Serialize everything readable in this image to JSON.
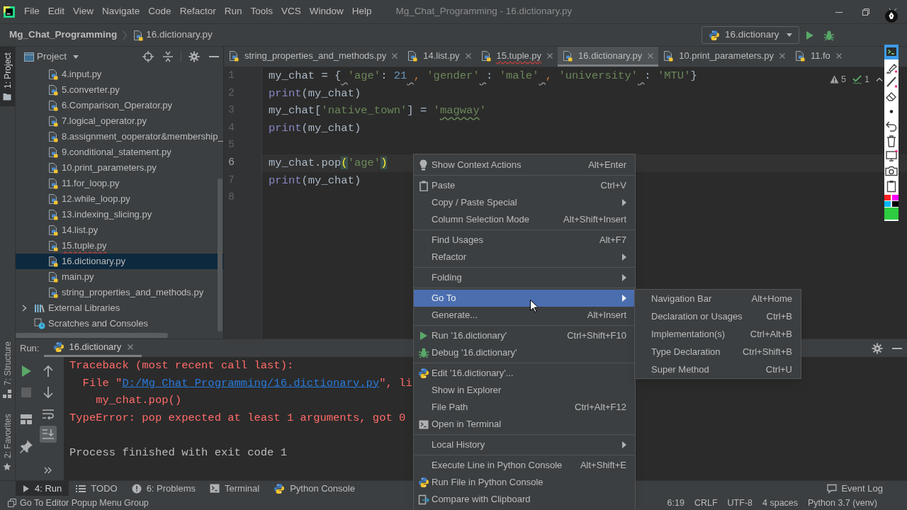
{
  "menu_bar": {
    "items": [
      "File",
      "Edit",
      "View",
      "Navigate",
      "Code",
      "Refactor",
      "Run",
      "Tools",
      "VCS",
      "Window",
      "Help"
    ],
    "title": "Mg_Chat_Programming - 16.dictionary.py"
  },
  "nav_bar": {
    "project": "Mg_Chat_Programming",
    "file": "16.dictionary.py",
    "run_config": "16.dictionary"
  },
  "tool_tabs": [
    {
      "label": "1: Project",
      "kind": "project",
      "selected": true
    },
    {
      "label": "7: Structure",
      "kind": "structure",
      "selected": false
    },
    {
      "label": "2: Favorites",
      "kind": "favorites",
      "selected": false
    }
  ],
  "project_panel": {
    "title": "Project",
    "tree": [
      {
        "children": [
          {
            "label": "4.input.py",
            "selected": false,
            "error": false
          },
          {
            "label": "5.converter.py",
            "selected": false,
            "error": false
          },
          {
            "label": "6.Comparison_Operator.py",
            "selected": false,
            "error": false
          },
          {
            "label": "7.logical_operator.py",
            "selected": false,
            "error": false
          },
          {
            "label": "8.assignment_ooperator&membership_",
            "selected": false,
            "error": false
          },
          {
            "label": "9.conditional_statement.py",
            "selected": false,
            "error": false
          },
          {
            "label": "10.print_parameters.py",
            "selected": false,
            "error": false
          },
          {
            "label": "11.for_loop.py",
            "selected": false,
            "error": false
          },
          {
            "label": "12.while_loop.py",
            "selected": false,
            "error": false
          },
          {
            "label": "13.indexing_slicing.py",
            "selected": false,
            "error": false
          },
          {
            "label": "14.list.py",
            "selected": false,
            "error": false
          },
          {
            "label": "15.tuple.py",
            "selected": false,
            "error": true
          },
          {
            "label": "16.dictionary.py",
            "selected": true,
            "error": false
          },
          {
            "label": "main.py",
            "selected": false,
            "error": false
          },
          {
            "label": "string_properties_and_methods.py",
            "selected": false,
            "error": false
          }
        ]
      },
      {
        "label": "External Libraries",
        "kind": "libraries",
        "expanded": false
      },
      {
        "label": "Scratches and Consoles",
        "kind": "scratches"
      }
    ]
  },
  "editor": {
    "tabs": [
      {
        "label": "string_properties_and_methods.py",
        "selected": false,
        "error": false
      },
      {
        "label": "14.list.py",
        "selected": false,
        "error": false
      },
      {
        "label": "15.tuple.py",
        "selected": false,
        "error": true
      },
      {
        "label": "16.dictionary.py",
        "selected": true,
        "error": false
      },
      {
        "label": "10.print_parameters.py",
        "selected": false,
        "error": false
      },
      {
        "label": "11.fo",
        "selected": false,
        "error": false
      }
    ],
    "lines": [
      {
        "number": "1",
        "current": false,
        "tokens": [
          {
            "text": "my_chat = { ",
            "kind": "plain",
            "space_warning": true
          },
          {
            "text": "'age'",
            "kind": "string",
            "space_warning": false
          },
          {
            "text": ": ",
            "kind": "plain",
            "space_warning": false
          },
          {
            "text": "21 ",
            "kind": "number",
            "space_warning": true
          },
          {
            "text": ", ",
            "kind": "comma",
            "space_warning": false
          },
          {
            "text": "'gender' ",
            "kind": "string",
            "space_warning": true
          },
          {
            "text": ": ",
            "kind": "plain",
            "space_warning": false
          },
          {
            "text": "'male' ",
            "kind": "string",
            "space_warning": true
          },
          {
            "text": ", ",
            "kind": "comma",
            "space_warning": false
          },
          {
            "text": "'university' ",
            "kind": "string",
            "space_warning": true
          },
          {
            "text": ": ",
            "kind": "plain",
            "space_warning": false
          },
          {
            "text": "'MTU'",
            "kind": "string",
            "space_warning": false
          },
          {
            "text": "}",
            "kind": "plain",
            "space_warning": false
          }
        ]
      },
      {
        "number": "2",
        "current": false,
        "tokens": [
          {
            "text": "print",
            "kind": "builtin",
            "space_warning": false
          },
          {
            "text": "(my_chat)",
            "kind": "plain",
            "space_warning": false
          }
        ]
      },
      {
        "number": "3",
        "current": false,
        "tokens": [
          {
            "text": "my_chat[",
            "kind": "plain",
            "space_warning": false
          },
          {
            "text": "'native_town'",
            "kind": "string",
            "space_warning": false
          },
          {
            "text": "] = ",
            "kind": "plain",
            "space_warning": false
          },
          {
            "text": "'",
            "kind": "string",
            "space_warning": false
          },
          {
            "text": "magway",
            "kind": "typo",
            "space_warning": false
          },
          {
            "text": "'",
            "kind": "string",
            "space_warning": false
          }
        ]
      },
      {
        "number": "4",
        "current": false,
        "tokens": [
          {
            "text": "print",
            "kind": "builtin",
            "space_warning": false
          },
          {
            "text": "(my_chat)",
            "kind": "plain",
            "space_warning": false
          }
        ]
      },
      {
        "number": "5",
        "current": false
      },
      {
        "number": "6",
        "current": true,
        "tokens": [
          {
            "text": "my_chat.pop",
            "kind": "plain",
            "space_warning": false
          },
          {
            "text": "(",
            "kind": "paren",
            "space_warning": false
          },
          {
            "text": "'age'",
            "kind": "string",
            "space_warning": false
          },
          {
            "text": ")",
            "kind": "paren",
            "space_warning": false
          }
        ]
      },
      {
        "number": "7",
        "current": false,
        "tokens": [
          {
            "text": "print",
            "kind": "builtin",
            "space_warning": false
          },
          {
            "text": "(my_chat)",
            "kind": "plain",
            "space_warning": false
          }
        ]
      },
      {
        "number": "8",
        "current": false
      }
    ],
    "inspections": {
      "warnings": "5",
      "weak_warnings": "1"
    }
  },
  "context_menu": {
    "groups": [
      [
        {
          "label": "Show Context Actions",
          "shortcut": "Alt+Enter",
          "kind": "hint",
          "submenu": false,
          "selected": false
        }
      ],
      [
        {
          "label": "Paste",
          "shortcut": "Ctrl+V",
          "kind": "paste",
          "submenu": false,
          "selected": false
        },
        {
          "label": "Copy / Paste Special",
          "kind": "plain",
          "submenu": true,
          "selected": false
        },
        {
          "label": "Column Selection Mode",
          "shortcut": "Alt+Shift+Insert",
          "kind": "plain",
          "submenu": false,
          "selected": false
        }
      ],
      [
        {
          "label": "Find Usages",
          "shortcut": "Alt+F7",
          "kind": "plain",
          "submenu": false,
          "selected": false
        },
        {
          "label": "Refactor",
          "kind": "plain",
          "submenu": true,
          "selected": false
        }
      ],
      [
        {
          "label": "Folding",
          "kind": "plain",
          "submenu": true,
          "selected": false
        }
      ],
      [
        {
          "label": "Go To",
          "kind": "plain",
          "submenu": true,
          "selected": true
        },
        {
          "label": "Generate...",
          "shortcut": "Alt+Insert",
          "kind": "plain",
          "submenu": false,
          "selected": false
        }
      ],
      [
        {
          "label": "Run '16.dictionary'",
          "shortcut": "Ctrl+Shift+F10",
          "kind": "run",
          "submenu": false,
          "selected": false
        },
        {
          "label": "Debug '16.dictionary'",
          "kind": "debug",
          "submenu": false,
          "selected": false
        }
      ],
      [
        {
          "label": "Edit '16.dictionary'...",
          "kind": "config",
          "submenu": false,
          "selected": false
        },
        {
          "label": "Show in Explorer",
          "kind": "plain",
          "submenu": false,
          "selected": false
        },
        {
          "label": "File Path",
          "shortcut": "Ctrl+Alt+F12",
          "kind": "plain",
          "submenu": false,
          "selected": false
        },
        {
          "label": "Open in Terminal",
          "kind": "terminal",
          "submenu": false,
          "selected": false
        }
      ],
      [
        {
          "label": "Local History",
          "kind": "plain",
          "submenu": true,
          "selected": false
        }
      ],
      [
        {
          "label": "Execute Line in Python Console",
          "shortcut": "Alt+Shift+E",
          "kind": "plain",
          "submenu": false,
          "selected": false
        },
        {
          "label": "Run File in Python Console",
          "kind": "console",
          "submenu": false,
          "selected": false
        },
        {
          "label": "Compare with Clipboard",
          "kind": "compare",
          "submenu": false,
          "selected": false
        }
      ]
    ]
  },
  "submenu": {
    "items": [
      {
        "label": "Navigation Bar",
        "shortcut": "Alt+Home"
      },
      {
        "label": "Declaration or Usages",
        "shortcut": "Ctrl+B"
      },
      {
        "label": "Implementation(s)",
        "shortcut": "Ctrl+Alt+B"
      },
      {
        "label": "Type Declaration",
        "shortcut": "Ctrl+Shift+B"
      },
      {
        "label": "Super Method",
        "shortcut": "Ctrl+U"
      }
    ]
  },
  "run_panel": {
    "title": "Run:",
    "tab": {
      "label": "16.dictionary",
      "selected": true
    },
    "toolbar": [
      {
        "kind": "rerun",
        "disabled": false
      },
      {
        "kind": "stop",
        "disabled": true
      },
      {
        "kind": "layout",
        "disabled": false
      },
      {
        "kind": "pin",
        "disabled": false
      }
    ],
    "toolbar_2": [
      {
        "kind": "up",
        "on": false
      },
      {
        "kind": "down",
        "on": false
      },
      {
        "kind": "soft_wrap",
        "on": false
      },
      {
        "kind": "scroll_to_end",
        "on": true
      },
      {
        "kind": "more",
        "on": false
      }
    ],
    "console": [
      {
        "kind": "text",
        "segments": [
          {
            "text": "Traceback (most recent call last):",
            "kind": "error"
          }
        ]
      },
      {
        "kind": "text",
        "segments": [
          {
            "text": "  File \"",
            "kind": "error"
          },
          {
            "text": "D:/Mg_Chat_Programming/16.dictionary.py",
            "kind": "link"
          },
          {
            "text": "\", li",
            "kind": "error"
          }
        ]
      },
      {
        "kind": "text",
        "segments": [
          {
            "text": "    my_chat.pop()",
            "kind": "error"
          }
        ]
      },
      {
        "kind": "text",
        "segments": [
          {
            "text": "TypeError: pop expected at least 1 arguments, got 0",
            "kind": "error"
          }
        ]
      },
      {
        "kind": "blank"
      },
      {
        "kind": "text",
        "segments": [
          {
            "text": "Process finished with exit code 1",
            "kind": "normal"
          }
        ]
      }
    ]
  },
  "bottom_bar": {
    "tools": [
      {
        "label": "4: Run",
        "kind": "run",
        "selected": true
      },
      {
        "label": "TODO",
        "kind": "todo",
        "selected": false
      },
      {
        "label": "6: Problems",
        "kind": "problems",
        "selected": false
      },
      {
        "label": "Terminal",
        "kind": "terminal",
        "selected": false
      },
      {
        "label": "Python Console",
        "kind": "python",
        "selected": false
      }
    ],
    "event_log": "Event Log"
  },
  "status_bar": {
    "message": "Go To Editor Popup Menu Group",
    "items": [
      "6:19",
      "CRLF",
      "UTF-8",
      "4 spaces",
      "Python 3.7 (venv)"
    ]
  },
  "annotation_toolbar": {
    "tools": [
      {
        "kind": "terminal",
        "selected": true
      },
      {
        "kind": "highlighter",
        "selected": false
      },
      {
        "kind": "line",
        "selected": false
      },
      {
        "kind": "eraser",
        "selected": false
      },
      {
        "kind": "dot",
        "selected": false
      }
    ],
    "actions": [
      {
        "kind": "undo"
      },
      {
        "kind": "trash"
      },
      {
        "kind": "screen"
      },
      {
        "kind": "camera"
      },
      {
        "kind": "clipboard"
      }
    ],
    "colors": [
      {
        "color": "#ff2020",
        "selected": false
      },
      {
        "color": "#ff00ff",
        "selected": false
      },
      {
        "color": "#00b7ff",
        "selected": false
      },
      {
        "color": "#000000",
        "selected": false
      },
      {
        "color": "#2ecc40",
        "selected": true
      }
    ]
  }
}
